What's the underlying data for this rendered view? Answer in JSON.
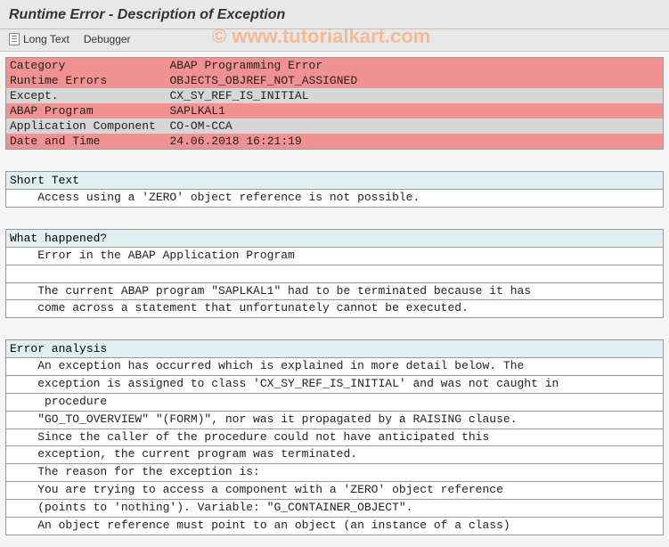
{
  "header": {
    "title": "Runtime Error - Description of Exception"
  },
  "toolbar": {
    "long_text": "Long Text",
    "debugger": "Debugger"
  },
  "watermark": "© www.tutorialkart.com",
  "info": {
    "rows": [
      {
        "cls": "row-red",
        "label": "Category",
        "value": "ABAP Programming Error"
      },
      {
        "cls": "row-red",
        "label": "Runtime Errors",
        "value": "OBJECTS_OBJREF_NOT_ASSIGNED"
      },
      {
        "cls": "row-gray",
        "label": "Except.",
        "value": "CX_SY_REF_IS_INITIAL"
      },
      {
        "cls": "row-red",
        "label": "ABAP Program",
        "value": "SAPLKAL1"
      },
      {
        "cls": "row-gray",
        "label": "Application Component",
        "value": "CO-OM-CCA"
      },
      {
        "cls": "row-red",
        "label": "Date and Time",
        "value": "24.06.2018 16:21:19"
      }
    ]
  },
  "sections": {
    "short_text": {
      "title": "Short Text",
      "lines": [
        "    Access using a 'ZERO' object reference is not possible."
      ]
    },
    "what_happened": {
      "title": "What happened?",
      "lines": [
        "    Error in the ABAP Application Program",
        "",
        "    The current ABAP program \"SAPLKAL1\" had to be terminated because it has",
        "    come across a statement that unfortunately cannot be executed."
      ]
    },
    "error_analysis": {
      "title": "Error analysis",
      "lines": [
        "    An exception has occurred which is explained in more detail below. The",
        "    exception is assigned to class 'CX_SY_REF_IS_INITIAL' and was not caught in",
        "     procedure",
        "    \"GO_TO_OVERVIEW\" \"(FORM)\", nor was it propagated by a RAISING clause.",
        "    Since the caller of the procedure could not have anticipated this",
        "    exception, the current program was terminated.",
        "    The reason for the exception is:",
        "    You are trying to access a component with a 'ZERO' object reference",
        "    (points to 'nothing'). Variable: \"G_CONTAINER_OBJECT\".",
        "    An object reference must point to an object (an instance of a class)"
      ]
    }
  }
}
